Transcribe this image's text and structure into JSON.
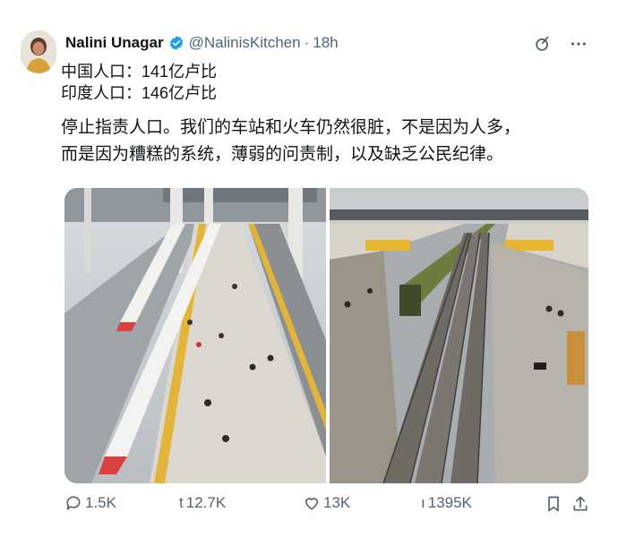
{
  "author": {
    "name": "Nalini Unagar",
    "handle": "@NalinisKitchen",
    "separator": "·",
    "time": "18h"
  },
  "post": {
    "line1": "中国人口：141亿卢比",
    "line2": "印度人口：146亿卢比",
    "paragraph_line1": "停止指责人口。我们的车站和火车仍然很脏，不是因为人多，",
    "paragraph_line2": "而是因为糟糕的系统，薄弱的问责制，以及缺乏公民纪律。"
  },
  "media": {
    "left_photo": "high-speed-train-station-photo",
    "right_photo": "old-railway-station-photo",
    "right_signs": [
      "",
      ""
    ]
  },
  "actions": {
    "replies": "1.5K",
    "reposts_prefix": "t",
    "reposts": "12.7K",
    "likes": "13K",
    "views_prefix": "ı",
    "views": "1395K"
  },
  "icons": {
    "verified": "verified-badge-icon",
    "grok": "grok-icon",
    "more": "more-icon",
    "reply": "reply-icon",
    "like": "heart-icon",
    "bookmark": "bookmark-icon",
    "share": "share-icon"
  },
  "colors": {
    "text": "#0f1419",
    "secondary": "#536471",
    "verified_blue": "#1d9bf0"
  }
}
